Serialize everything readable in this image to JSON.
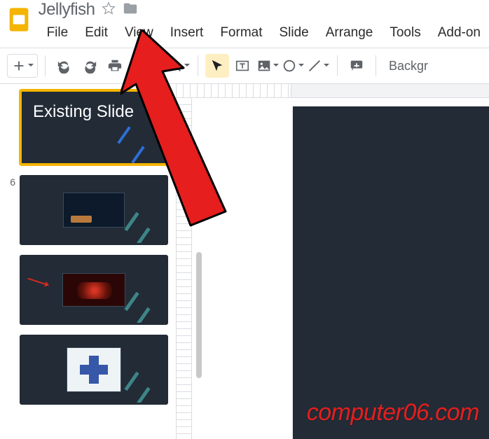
{
  "header": {
    "doc_title": "Jellyfish"
  },
  "menu": {
    "file": "File",
    "edit": "Edit",
    "view": "View",
    "insert": "Insert",
    "format": "Format",
    "slide": "Slide",
    "arrange": "Arrange",
    "tools": "Tools",
    "addons": "Add-on"
  },
  "toolbar": {
    "background_label": "Backgr"
  },
  "filmstrip": {
    "num_6": "6",
    "slide1_title": "Existing Slide"
  },
  "watermark": "computer06.com"
}
